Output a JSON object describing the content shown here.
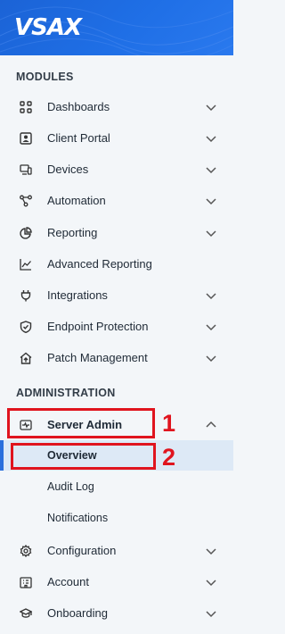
{
  "brand": {
    "logo_text": "VSAX"
  },
  "sections": {
    "modules": "MODULES",
    "administration": "ADMINISTRATION"
  },
  "modules": [
    {
      "label": "Dashboards",
      "icon": "grid-icon",
      "expandable": true
    },
    {
      "label": "Client Portal",
      "icon": "user-card-icon",
      "expandable": true
    },
    {
      "label": "Devices",
      "icon": "devices-icon",
      "expandable": true
    },
    {
      "label": "Automation",
      "icon": "workflow-icon",
      "expandable": true
    },
    {
      "label": "Reporting",
      "icon": "pie-chart-icon",
      "expandable": true
    },
    {
      "label": "Advanced Reporting",
      "icon": "line-chart-icon",
      "expandable": false
    },
    {
      "label": "Integrations",
      "icon": "plug-icon",
      "expandable": true
    },
    {
      "label": "Endpoint Protection",
      "icon": "shield-icon",
      "expandable": true
    },
    {
      "label": "Patch Management",
      "icon": "home-upload-icon",
      "expandable": true
    }
  ],
  "administration": {
    "server_admin": {
      "label": "Server Admin",
      "icon": "server-pulse-icon",
      "expanded": true
    },
    "sub_items": [
      {
        "label": "Overview",
        "active": true
      },
      {
        "label": "Audit Log",
        "active": false
      },
      {
        "label": "Notifications",
        "active": false
      }
    ],
    "items": [
      {
        "label": "Configuration",
        "icon": "gear-icon",
        "expandable": true
      },
      {
        "label": "Account",
        "icon": "building-icon",
        "expandable": true
      },
      {
        "label": "Onboarding",
        "icon": "graduation-cap-icon",
        "expandable": true
      }
    ]
  },
  "annotations": [
    {
      "label": "1"
    },
    {
      "label": "2"
    }
  ],
  "colors": {
    "header": "#1f6fe6",
    "sidebar_bg": "#f3f6f9",
    "active_bg": "#dde9f6",
    "active_bar": "#2a6fdc",
    "annotation": "#e0141e"
  }
}
